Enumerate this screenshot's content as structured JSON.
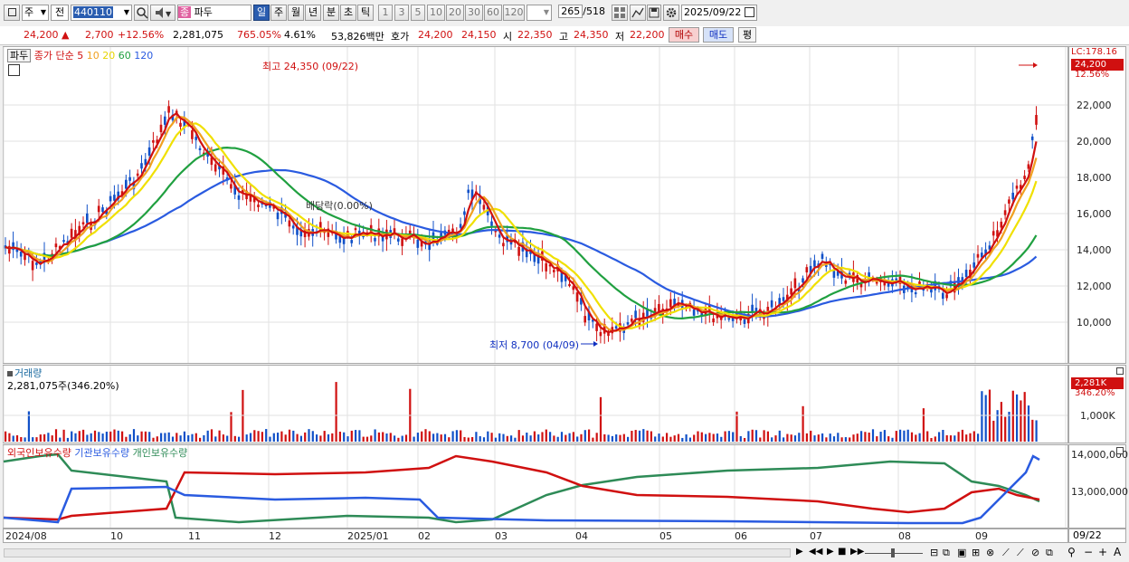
{
  "toolbar": {
    "market_select": "주",
    "range_select": "전",
    "code_value": "440110",
    "stock_name": "파두",
    "stock_badge": "종",
    "period_buttons": [
      "일",
      "주",
      "월",
      "년",
      "분",
      "초",
      "틱"
    ],
    "interval_buttons": [
      "1",
      "3",
      "5",
      "10",
      "20",
      "30",
      "60",
      "120"
    ],
    "count_value": "265",
    "count_total": "/518",
    "date_value": "2025/09/22"
  },
  "quote": {
    "price": "24,200",
    "change": "2,700",
    "change_pct": "+12.56%",
    "volume": "2,281,075",
    "turnover_pct": "765.05%",
    "ratio": "4.61%",
    "amount": "53,826백만",
    "hoga_label": "호가",
    "ask": "24,200",
    "bid": "24,150",
    "open_label": "시",
    "open": "22,350",
    "high_label": "고",
    "high": "24,350",
    "low_label": "저",
    "low": "22,200",
    "buy_button": "매수",
    "sell_button": "매도",
    "eval_button": "평"
  },
  "price_panel": {
    "name_tag": "파두",
    "ma_label": "종가 단순",
    "ma_periods": [
      "5",
      "10",
      "20",
      "60",
      "120"
    ],
    "ma_colors": [
      "#d01010",
      "#f0a020",
      "#f0e000",
      "#20a040",
      "#2a5be0"
    ],
    "high_annotation": "최고 24,350 (09/22)",
    "low_annotation": "최저 8,700 (04/09)",
    "dividend_label": "배당락(0.00%)",
    "lc_label": "LC:178.16",
    "current_tag": "24,200",
    "current_pct": "12.56%",
    "y_ticks": [
      "22,000",
      "20,000",
      "18,000",
      "16,000",
      "14,000",
      "12,000",
      "10,000"
    ]
  },
  "volume_panel": {
    "title": "거래량",
    "value": "2,281,075주(346.20%)",
    "tag": "2,281K",
    "tag_pct": "346.20%",
    "y_tick": "1,000K"
  },
  "holding_panel": {
    "legend": [
      "외국인보유수량",
      "기관보유수량",
      "개인보유수량"
    ],
    "colors": [
      "#d01010",
      "#2a5be0",
      "#2e8b57"
    ],
    "y_ticks": [
      "14,000,000",
      "13,000,000"
    ]
  },
  "x_axis": {
    "labels": [
      "2024/08",
      "10",
      "11",
      "12",
      "2025/01",
      "02",
      "03",
      "04",
      "05",
      "06",
      "07",
      "08",
      "09"
    ],
    "end_label": "09/22"
  }
}
